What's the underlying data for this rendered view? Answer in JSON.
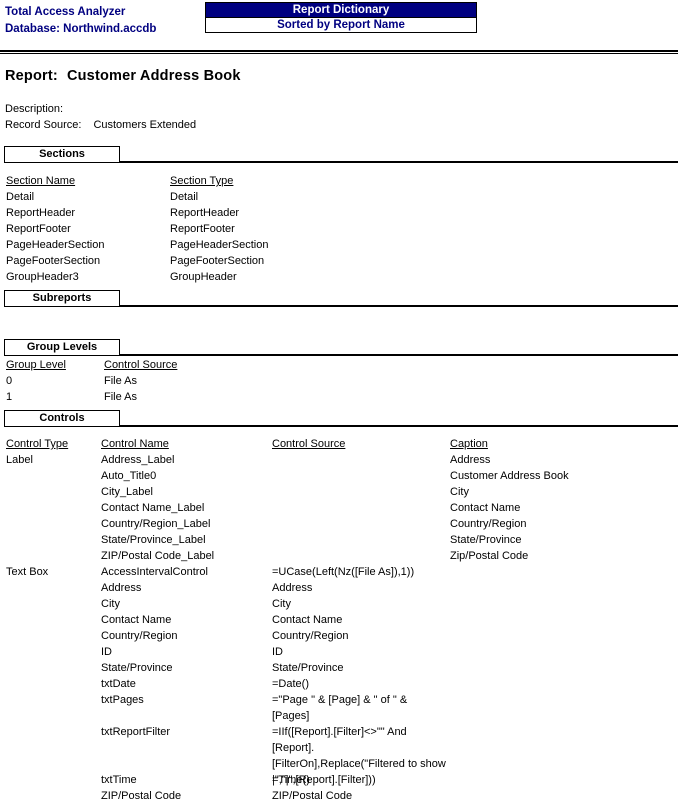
{
  "header": {
    "brand": "Total Access Analyzer",
    "database_line": "Database: Northwind.accdb",
    "dictionary_title": "Report Dictionary",
    "dictionary_subtitle": "Sorted by Report Name",
    "brand_color": "#000080",
    "bar_bg_color": "#000080",
    "bar_text_color": "#FFFFFF"
  },
  "report": {
    "title_label": "Report:",
    "title_value": "Customer Address Book",
    "description_label": "Description:",
    "description_value": "",
    "record_source_label": "Record Source:",
    "record_source_value": "Customers Extended"
  },
  "sections": {
    "heading": "Sections",
    "columns": [
      "Section Name",
      "Section Type"
    ],
    "rows": [
      [
        "Detail",
        "Detail"
      ],
      [
        "ReportHeader",
        "ReportHeader"
      ],
      [
        "ReportFooter",
        "ReportFooter"
      ],
      [
        "PageHeaderSection",
        "PageHeaderSection"
      ],
      [
        "PageFooterSection",
        "PageFooterSection"
      ],
      [
        "GroupHeader3",
        "GroupHeader"
      ]
    ]
  },
  "subreports": {
    "heading": "Subreports",
    "rows": []
  },
  "group_levels": {
    "heading": "Group Levels",
    "columns": [
      "Group Level",
      "Control Source"
    ],
    "rows": [
      [
        "0",
        "File As"
      ],
      [
        "1",
        "File As"
      ]
    ]
  },
  "controls": {
    "heading": "Controls",
    "columns": [
      "Control Type",
      "Control Name",
      "Control Source",
      "Caption"
    ],
    "rows": [
      {
        "type": "Label",
        "name": "Address_Label",
        "source": "",
        "caption": "Address",
        "lines": 1
      },
      {
        "type": "",
        "name": "Auto_Title0",
        "source": "",
        "caption": "Customer Address Book",
        "lines": 1
      },
      {
        "type": "",
        "name": "City_Label",
        "source": "",
        "caption": "City",
        "lines": 1
      },
      {
        "type": "",
        "name": "Contact Name_Label",
        "source": "",
        "caption": "Contact Name",
        "lines": 1
      },
      {
        "type": "",
        "name": "Country/Region_Label",
        "source": "",
        "caption": "Country/Region",
        "lines": 1
      },
      {
        "type": "",
        "name": "State/Province_Label",
        "source": "",
        "caption": "State/Province",
        "lines": 1
      },
      {
        "type": "",
        "name": "ZIP/Postal Code_Label",
        "source": "",
        "caption": "Zip/Postal Code",
        "lines": 1
      },
      {
        "type": "Text Box",
        "name": "AccessIntervalControl",
        "source": "=UCase(Left(Nz([File As]),1))",
        "caption": "",
        "lines": 1
      },
      {
        "type": "",
        "name": "Address",
        "source": "Address",
        "caption": "",
        "lines": 1
      },
      {
        "type": "",
        "name": "City",
        "source": "City",
        "caption": "",
        "lines": 1
      },
      {
        "type": "",
        "name": "Contact Name",
        "source": "Contact Name",
        "caption": "",
        "lines": 1
      },
      {
        "type": "",
        "name": "Country/Region",
        "source": "Country/Region",
        "caption": "",
        "lines": 1
      },
      {
        "type": "",
        "name": "ID",
        "source": "ID",
        "caption": "",
        "lines": 1
      },
      {
        "type": "",
        "name": "State/Province",
        "source": "State/Province",
        "caption": "",
        "lines": 1
      },
      {
        "type": "",
        "name": "txtDate",
        "source": "=Date()",
        "caption": "",
        "lines": 1
      },
      {
        "type": "",
        "name": "txtPages",
        "source": "=\"Page \" & [Page] & \" of \" & [Pages]",
        "caption": "",
        "lines": 2
      },
      {
        "type": "",
        "name": "txtReportFilter",
        "source": "=IIf([Report].[Filter]<>\"\" And [Report].[FilterOn],Replace(\"Filtered to show |\",\"|\",[Report].[Filter]))",
        "caption": "",
        "lines": 3
      },
      {
        "type": "",
        "name": "txtTime",
        "source": "=Time()",
        "caption": "",
        "lines": 1
      },
      {
        "type": "",
        "name": "ZIP/Postal Code",
        "source": "ZIP/Postal Code",
        "caption": "",
        "lines": 1
      }
    ]
  }
}
